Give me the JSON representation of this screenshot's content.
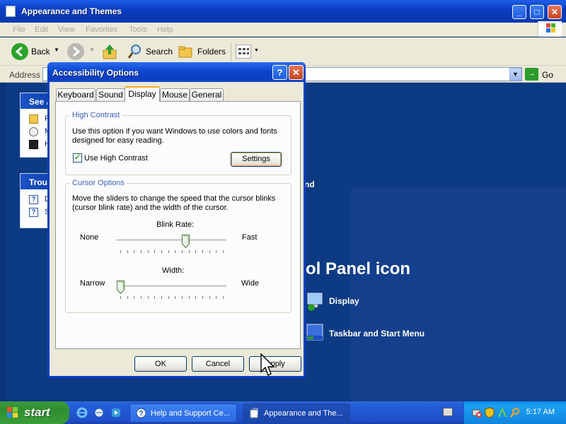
{
  "explorer": {
    "title": "Appearance and Themes",
    "menu": [
      "File",
      "Edit",
      "View",
      "Favorites",
      "Tools",
      "Help"
    ],
    "toolbar": {
      "back": "Back",
      "search": "Search",
      "folders": "Folders"
    },
    "address_label": "Address",
    "go_label": "Go",
    "see_also_head": "See A",
    "see_also_items": [
      "Fo",
      "Me",
      "Hi"
    ],
    "troubleshooters_head": "Troub",
    "troubleshooters_items": [
      "Di",
      "Sc"
    ],
    "right_texts": {
      "fragment": "nd",
      "cp_icon_fragment": "ol Panel icon",
      "display": "Display",
      "taskbar": "Taskbar and Start Menu"
    }
  },
  "dialog": {
    "title": "Accessibility Options",
    "help_label": "?",
    "close_label": "✕",
    "tabs": [
      "Keyboard",
      "Sound",
      "Display",
      "Mouse",
      "General"
    ],
    "active_tab": "Display",
    "high_contrast": {
      "title": "High Contrast",
      "description_line1": "Use this option if you want Windows to use colors and fonts",
      "description_line2": "designed for easy reading.",
      "checkbox_label": "Use High Contrast",
      "checked": true,
      "settings_label": "Settings"
    },
    "cursor_options": {
      "title": "Cursor Options",
      "description_line1": "Move the sliders to change the speed that the cursor blinks",
      "description_line2": "(cursor blink rate) and the width of the cursor.",
      "blink_rate": {
        "label": "Blink Rate:",
        "min_label": "None",
        "max_label": "Fast",
        "value": 0.64
      },
      "width": {
        "label": "Width:",
        "min_label": "Narrow",
        "max_label": "Wide",
        "value": 0.0
      }
    },
    "buttons": {
      "ok": "OK",
      "cancel": "Cancel",
      "apply": "Apply"
    }
  },
  "taskbar": {
    "start_label": "start",
    "tasks": [
      "Help and Support Ce...",
      "Appearance and The..."
    ],
    "clock": "5:17 AM"
  },
  "colors": {
    "xp_blue": "#0a3fc2",
    "start_green": "#2f8e2f",
    "group_title": "#3c5fbc",
    "tab_accent": "#f5a623"
  }
}
